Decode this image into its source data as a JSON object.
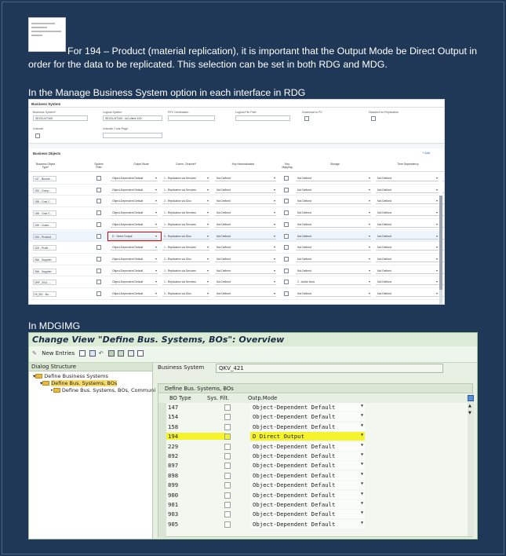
{
  "paragraphs": {
    "intro": "For 194 – Product (material replication), it is important that the Output Mode be Direct Output in order for the data to be replicated. This selection can be set in both RDG and MDG.",
    "rdg_heading": "In the Manage Business System option in each interface in RDG",
    "mdg_heading": "In MDGIMG"
  },
  "rdg": {
    "header": "Business System",
    "fields": {
      "business_system_label": "Business System*",
      "business_system_value": "SE2CLNT100",
      "logical_system_label": "Logical System",
      "logical_system_value": "SE2CLNT100 - ls2-client 100",
      "rfc_destination_label": "RFC Destination",
      "logical_file_path_label": "Logical File Path",
      "download_pc_label": "Download to PC",
      "disabled_replication_label": "Disabled for Replication",
      "unicode_label": "Unicode",
      "unicode_code_page_label": "Unicode Code Page"
    },
    "bo_title": "Business Objects",
    "add_label": "+ Add",
    "columns": [
      "Business Object Type*",
      "System Filter",
      "Output Mode",
      "Comm. Channel*",
      "Key Harmonization",
      "Key Mapping",
      "Storage",
      "Time Dependency",
      "MDC Create Template"
    ],
    "rows": [
      {
        "bo": "147 - Busine...",
        "mode": "Object-Dependent Default",
        "channel": "1 - Replication via Services",
        "key": "Not Defined",
        "storage": "Not Defined",
        "time": "Not Defined"
      },
      {
        "bo": "154 - Comp...",
        "mode": "Object-Dependent Default",
        "channel": "1 - Replication via Services",
        "key": "Not Defined",
        "storage": "Not Defined",
        "time": "Not Defined"
      },
      {
        "bo": "158 - Cost C...",
        "mode": "Object-Dependent Default",
        "channel": "2 - Replication via IDoc",
        "key": "Not Defined",
        "storage": "Not Defined",
        "time": "Not Defined"
      },
      {
        "bo": "158 - Cost C...",
        "mode": "Object-Dependent Default",
        "channel": "1 - Replication via Services",
        "key": "Not Defined",
        "storage": "Not Defined",
        "time": "Not Defined"
      },
      {
        "bo": "159 - Custo...",
        "mode": "Object-Dependent Default",
        "channel": "1 - Replication via Services",
        "key": "Not Defined",
        "storage": "Not Defined",
        "time": "Not Defined"
      },
      {
        "bo": "194 - Product",
        "mode": "D - Direct Output",
        "channel": "2 - Replication via IDoc",
        "key": "Not Defined",
        "storage": "Not Defined",
        "time": "Not Defined"
      },
      {
        "bo": "229 - Profit ...",
        "mode": "Object-Dependent Default",
        "channel": "1 - Replication via Services",
        "key": "Not Defined",
        "storage": "Not Defined",
        "time": "Not Defined"
      },
      {
        "bo": "266 - Supplier",
        "mode": "Object-Dependent Default",
        "channel": "2 - Replication via IDoc",
        "key": "Not Defined",
        "storage": "Not Defined",
        "time": "Not Defined"
      },
      {
        "bo": "266 - Supplier",
        "mode": "Object-Dependent Default",
        "channel": "1 - Replication via Services",
        "key": "Not Defined",
        "storage": "Not Defined",
        "time": "Not Defined"
      },
      {
        "bo": "DRF_0011 -...",
        "mode": "Object-Dependent Default",
        "channel": "1 - Replication via Services",
        "key": "Not Defined",
        "storage": "2 - Active Area",
        "time": "Not Defined"
      },
      {
        "bo": "HI_BO - Bu...",
        "mode": "Object-Dependent Default",
        "channel": "2 - Replication via IDoc",
        "key": "Not Defined",
        "storage": "Not Defined",
        "time": "Not Defined"
      }
    ]
  },
  "sap": {
    "title": "Change View \"Define Bus. Systems,  BOs\": Overview",
    "new_entries": "New Entries",
    "dialog_structure": "Dialog Structure",
    "tree": [
      "Define Business Systems",
      "Define Bus. Systems,  BOs",
      "Define Bus. Systems, BOs, Communi"
    ],
    "business_system_label": "Business System",
    "business_system_value": "QKV_421",
    "grid_title": "Define Bus. Systems,  BOs",
    "columns": [
      "BO Type",
      "Sys. Filt.",
      "Outp.Mode"
    ],
    "rows": [
      {
        "bo": "147",
        "mode": "Object-Dependent Default"
      },
      {
        "bo": "154",
        "mode": "Object-Dependent Default"
      },
      {
        "bo": "158",
        "mode": "Object-Dependent Default"
      },
      {
        "bo": "194",
        "mode": "D Direct Output"
      },
      {
        "bo": "229",
        "mode": "Object-Dependent Default"
      },
      {
        "bo": "892",
        "mode": "Object-Dependent Default"
      },
      {
        "bo": "897",
        "mode": "Object-Dependent Default"
      },
      {
        "bo": "898",
        "mode": "Object-Dependent Default"
      },
      {
        "bo": "899",
        "mode": "Object-Dependent Default"
      },
      {
        "bo": "900",
        "mode": "Object-Dependent Default"
      },
      {
        "bo": "901",
        "mode": "Object-Dependent Default"
      },
      {
        "bo": "903",
        "mode": "Object-Dependent Default"
      },
      {
        "bo": "905",
        "mode": "Object-Dependent Default"
      }
    ],
    "highlight_row": 3,
    "highlight_color": "#f4f32c"
  }
}
